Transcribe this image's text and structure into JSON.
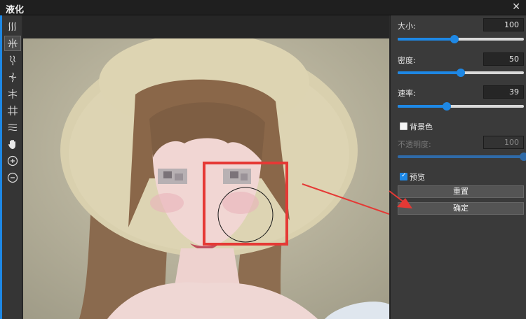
{
  "window": {
    "title": "液化",
    "close_glyph": "✕"
  },
  "tools": [
    {
      "name": "forward-warp-tool-icon",
      "active": false
    },
    {
      "name": "reconstruct-tool-icon",
      "active": true
    },
    {
      "name": "twirl-tool-icon",
      "active": false
    },
    {
      "name": "twirl-ccw-tool-icon",
      "active": false
    },
    {
      "name": "pucker-tool-icon",
      "active": false
    },
    {
      "name": "bloat-tool-icon",
      "active": false
    },
    {
      "name": "push-left-tool-icon",
      "active": false
    },
    {
      "name": "hand-tool-icon",
      "active": false
    },
    {
      "name": "zoom-in-tool-icon",
      "active": false
    },
    {
      "name": "zoom-out-tool-icon",
      "active": false
    }
  ],
  "panel": {
    "size": {
      "label": "大小:",
      "value": "100",
      "level": 0.45
    },
    "density": {
      "label": "密度:",
      "value": "50",
      "level": 0.5
    },
    "rate": {
      "label": "速率:",
      "value": "39",
      "level": 0.39
    },
    "background": {
      "label": "背景色",
      "checked": false
    },
    "opacity": {
      "label": "不透明度:",
      "value": "100",
      "level": 1.0
    },
    "preview": {
      "label": "预览",
      "checked": true
    },
    "reset_label": "重置",
    "confirm_label": "确定"
  },
  "colors": {
    "accent": "#1e88e5",
    "annotation": "#e53935",
    "panel_bg": "#3a3a3a"
  }
}
